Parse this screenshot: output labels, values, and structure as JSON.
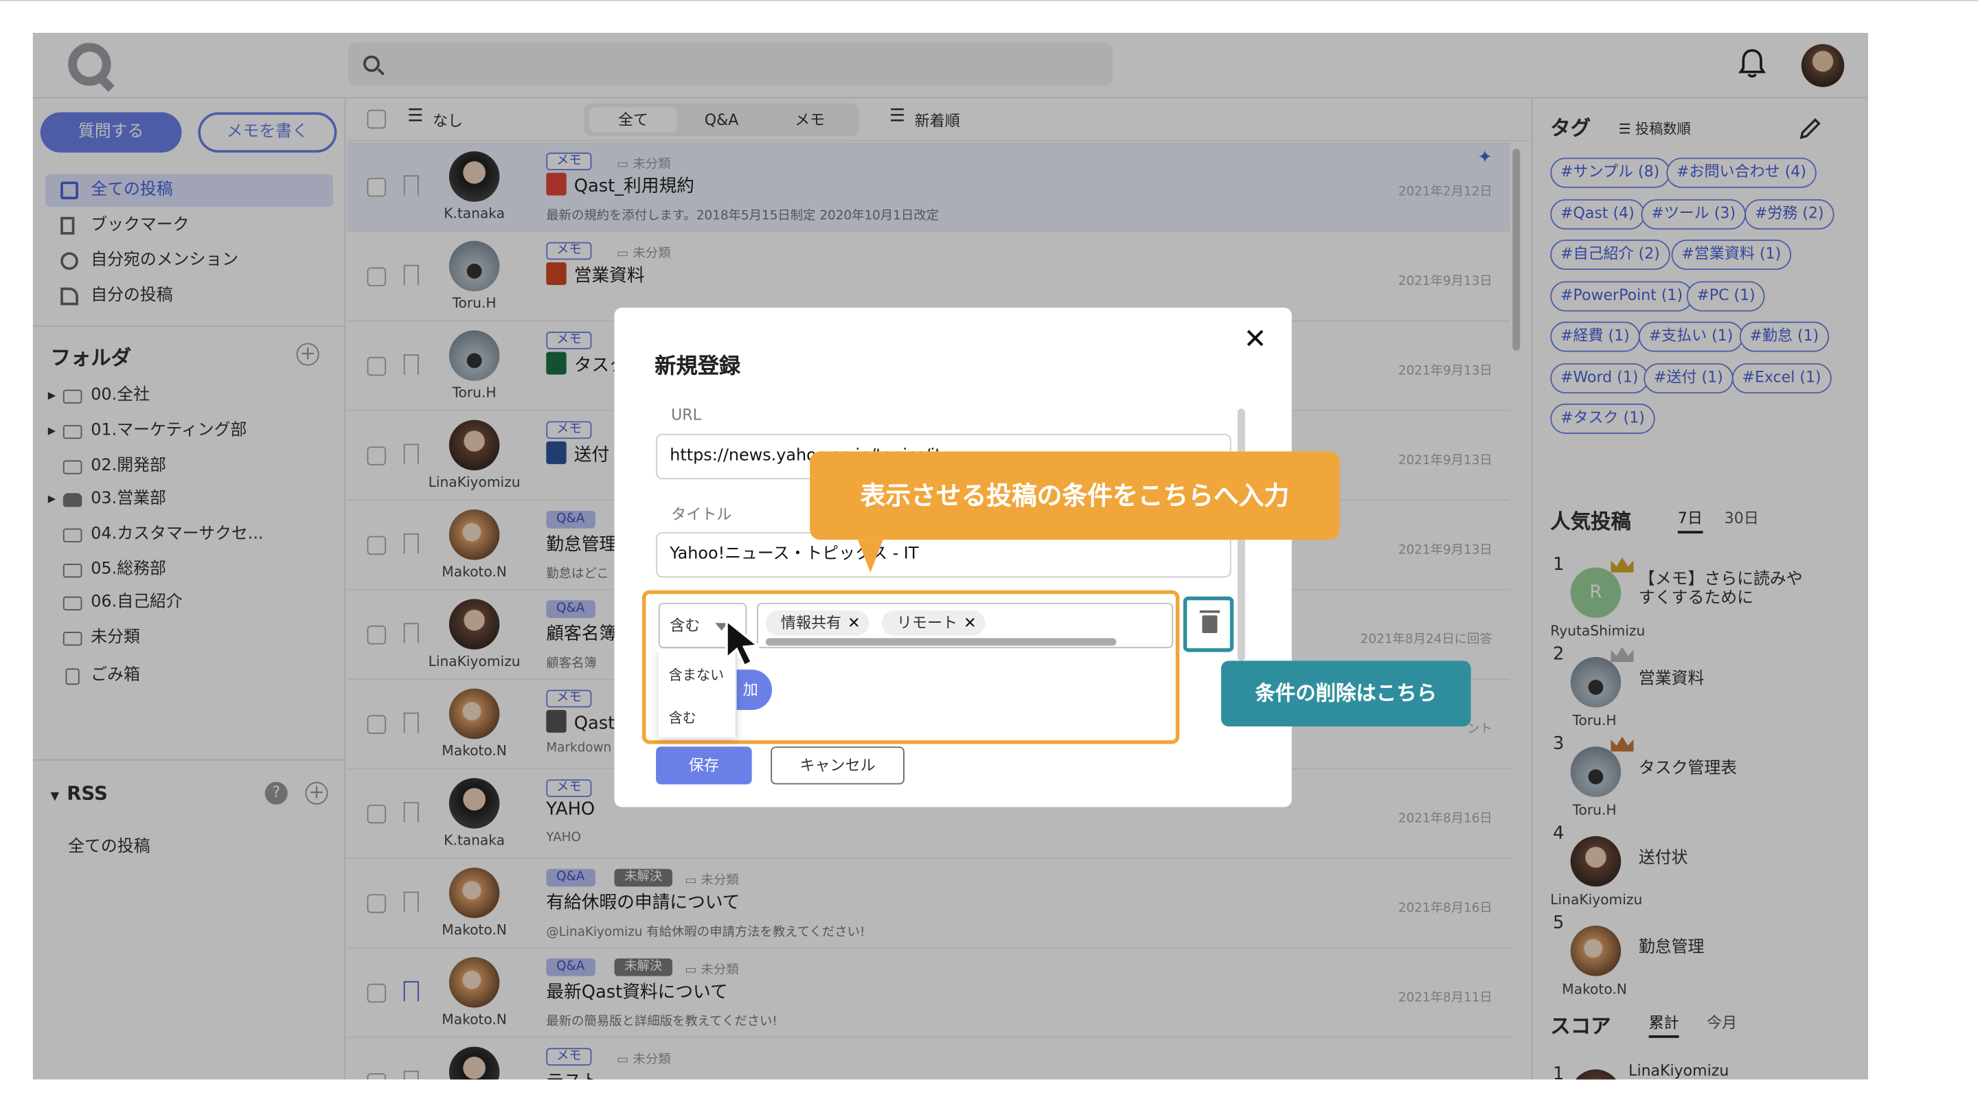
{
  "header": {
    "search_placeholder": ""
  },
  "sidebar": {
    "ask_button": "質問する",
    "memo_button": "メモを書く",
    "nav": [
      {
        "label": "全ての投稿",
        "active": true
      },
      {
        "label": "ブックマーク"
      },
      {
        "label": "自分宛のメンション"
      },
      {
        "label": "自分の投稿"
      }
    ],
    "folder_title": "フォルダ",
    "folders": [
      "00.全社",
      "01.マーケティング部",
      "02.開発部",
      "03.営業部",
      "04.カスタマーサクセ...",
      "05.総務部",
      "06.自己紹介",
      "未分類",
      "ごみ箱"
    ],
    "rss_title": "RSS",
    "rss_items": [
      "全ての投稿"
    ]
  },
  "toolbar": {
    "filter_label": "なし",
    "tabs": [
      "全て",
      "Q&A",
      "メモ"
    ],
    "sort_label": "新着順"
  },
  "posts": [
    {
      "user": "K.tanaka",
      "tags": [
        "メモ"
      ],
      "category": "未分類",
      "title": "Qast_利用規約",
      "subtitle": "最新の規約を添付します。2018年5月15日制定 2020年10月1日改定",
      "date": "2021年2月12日"
    },
    {
      "user": "Toru.H",
      "tags": [
        "メモ"
      ],
      "category": "未分類",
      "title": "営業資料",
      "subtitle": "",
      "date": "2021年9月13日"
    },
    {
      "user": "Toru.H",
      "tags": [
        "メモ"
      ],
      "category": "",
      "title": "タスク",
      "subtitle": "",
      "date": "2021年9月13日"
    },
    {
      "user": "LinaKiyomizu",
      "tags": [
        "メモ"
      ],
      "category": "",
      "title": "送付",
      "subtitle": "",
      "date": "2021年9月13日"
    },
    {
      "user": "Makoto.N",
      "tags": [
        "Q&A"
      ],
      "category": "",
      "title": "勤怠管理",
      "subtitle": "勤怠はどこ",
      "date": "2021年9月13日"
    },
    {
      "user": "LinaKiyomizu",
      "tags": [
        "Q&A"
      ],
      "category": "",
      "title": "顧客名簿",
      "subtitle": "顧客名簿",
      "date": "2021年8月24日に回答"
    },
    {
      "user": "Makoto.N",
      "tags": [
        "メモ"
      ],
      "category": "",
      "title": "Qast",
      "subtitle": "Markdown",
      "date": "ント"
    },
    {
      "user": "K.tanaka",
      "tags": [
        "メモ"
      ],
      "category": "",
      "title": "YAHO",
      "subtitle": "YAHO",
      "date": "2021年8月16日"
    },
    {
      "user": "Makoto.N",
      "tags": [
        "Q&A",
        "未解決"
      ],
      "category": "未分類",
      "title": "有給休暇の申請について",
      "subtitle": "@LinaKiyomizu 有給休暇の申請方法を教えてください!",
      "date": "2021年8月16日"
    },
    {
      "user": "Makoto.N",
      "tags": [
        "Q&A",
        "未解決"
      ],
      "category": "未分類",
      "title": "最新Qast資料について",
      "subtitle": "最新の簡易版と詳細版を教えてください!",
      "date": "2021年8月11日"
    },
    {
      "user": "",
      "tags": [
        "メモ"
      ],
      "category": "未分類",
      "title": "テスト",
      "subtitle": "",
      "date": ""
    }
  ],
  "right": {
    "tag_title": "タグ",
    "tag_sort": "投稿数順",
    "hashtags": [
      "#サンプル (8)",
      "#お問い合わせ (4)",
      "#Qast (4)",
      "#ツール (3)",
      "#労務 (2)",
      "#自己紹介 (2)",
      "#営業資料 (1)",
      "#PowerPoint (1)",
      "#PC (1)",
      "#経費 (1)",
      "#支払い (1)",
      "#勤怠 (1)",
      "#Word (1)",
      "#送付 (1)",
      "#Excel (1)",
      "#タスク (1)"
    ],
    "popular_title": "人気投稿",
    "popular_tabs": [
      "7日",
      "30日"
    ],
    "popular": [
      {
        "rank": "1",
        "user": "RyutaShimizu",
        "title": "【メモ】さらに読みやすくするために",
        "avatar_letter": "R"
      },
      {
        "rank": "2",
        "user": "Toru.H",
        "title": "営業資料"
      },
      {
        "rank": "3",
        "user": "Toru.H",
        "title": "タスク管理表"
      },
      {
        "rank": "4",
        "user": "LinaKiyomizu",
        "title": "送付状"
      },
      {
        "rank": "5",
        "user": "Makoto.N",
        "title": "勤怠管理"
      }
    ],
    "score_title": "スコア",
    "score_tabs": [
      "累計",
      "今月"
    ],
    "score_first_rank": "1",
    "score_first_user": "LinaKiyomizu"
  },
  "modal": {
    "title": "新規登録",
    "url_label": "URL",
    "url_value": "https://news.yahoo.co.jp/topics/it",
    "title_label": "タイトル",
    "title_value": "Yahoo!ニュース・トピックス - IT",
    "condition_select": "含む",
    "condition_options": [
      "含まない",
      "含む"
    ],
    "chips": [
      "情報共有",
      "リモート"
    ],
    "add_button": "加",
    "save_button": "保存",
    "cancel_button": "キャンセル"
  },
  "callouts": {
    "condition": "表示させる投稿の条件をこちらへ入力",
    "delete": "条件の削除はこちら"
  },
  "colors": {
    "accent": "#6b80e6",
    "callout_orange": "#f0a63a",
    "callout_teal": "#2f8e9d"
  }
}
